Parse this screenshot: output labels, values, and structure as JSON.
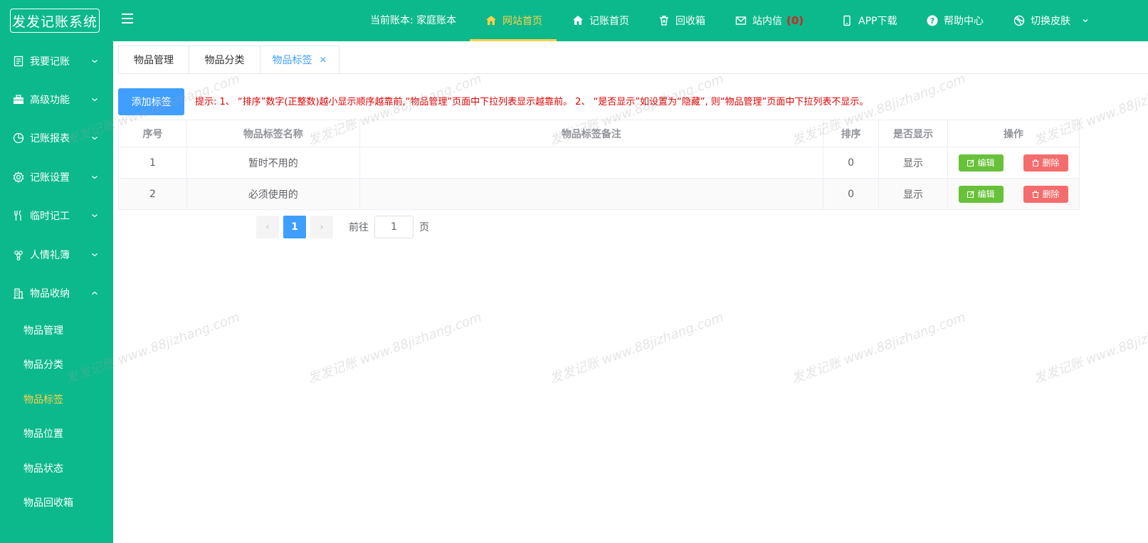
{
  "header": {
    "logo": "发发记账系统",
    "account_label": "当前账本: 家庭账本",
    "nav": [
      {
        "label": "网站首页",
        "icon": "home-icon",
        "active": true
      },
      {
        "label": "记账首页",
        "icon": "home-icon"
      },
      {
        "label": "回收箱",
        "icon": "trash-icon"
      },
      {
        "label": "站内信",
        "icon": "mail-icon",
        "count": "(0)"
      },
      {
        "label": "APP下载",
        "icon": "phone-icon"
      },
      {
        "label": "帮助中心",
        "icon": "help-icon"
      },
      {
        "label": "切换皮肤",
        "icon": "palette-icon"
      }
    ]
  },
  "sidebar": {
    "menus": [
      {
        "label": "我要记账",
        "icon": "document-icon"
      },
      {
        "label": "高级功能",
        "icon": "briefcase-icon"
      },
      {
        "label": "记账报表",
        "icon": "pie-chart-icon"
      },
      {
        "label": "记账设置",
        "icon": "gear-icon"
      },
      {
        "label": "临时记工",
        "icon": "fork-knife-icon"
      },
      {
        "label": "人情礼簿",
        "icon": "grapes-icon"
      },
      {
        "label": "物品收纳",
        "icon": "building-icon",
        "expanded": true
      }
    ],
    "submenu": [
      {
        "label": "物品管理"
      },
      {
        "label": "物品分类"
      },
      {
        "label": "物品标签",
        "active": true
      },
      {
        "label": "物品位置"
      },
      {
        "label": "物品状态"
      },
      {
        "label": "物品回收箱"
      }
    ]
  },
  "tabs": [
    {
      "label": "物品管理"
    },
    {
      "label": "物品分类"
    },
    {
      "label": "物品标签",
      "active": true,
      "close": "×"
    }
  ],
  "toolbar": {
    "add_label": "添加标签",
    "tip": "提示:  1、 “排序”数字(正整数)越小显示顺序越靠前,“物品管理”页面中下拉列表显示越靠前。  2、 “是否显示”如设置为“隐藏”, 则“物品管理”页面中下拉列表不显示。"
  },
  "table": {
    "columns": [
      "序号",
      "物品标签名称",
      "物品标签备注",
      "排序",
      "是否显示",
      "操作"
    ],
    "rows": [
      {
        "no": "1",
        "name": "暂时不用的",
        "note": "",
        "sort": "0",
        "show": "显示"
      },
      {
        "no": "2",
        "name": "必须使用的",
        "note": "",
        "sort": "0",
        "show": "显示"
      }
    ],
    "edit_label": "编辑",
    "delete_label": "删除"
  },
  "pager": {
    "prev": "‹",
    "current": "1",
    "next": "›",
    "goto_label": "前往",
    "goto_value": "1",
    "unit": "页"
  },
  "watermark": "发发记账 www.88jizhang.com",
  "colors": {
    "primary": "#0bb98c",
    "accent": "#ffd04b",
    "blue": "#409eff",
    "green": "#67c23a",
    "red": "#f56c6c"
  }
}
